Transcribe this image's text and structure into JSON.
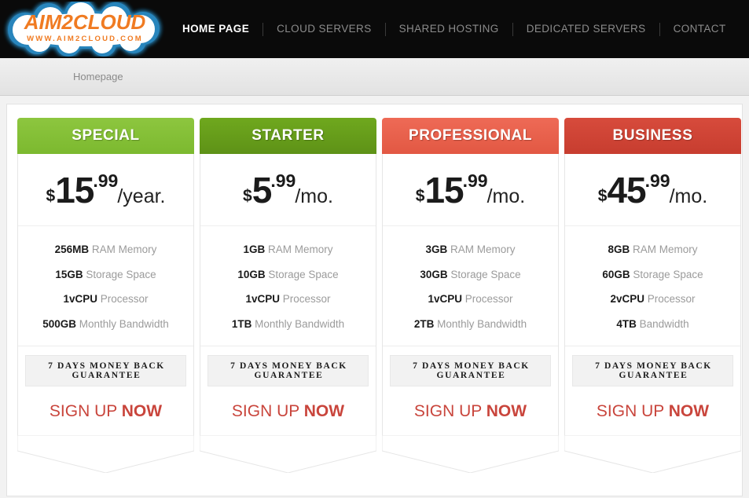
{
  "site": {
    "logo_text": "AIM2CLOUD",
    "logo_sub": "WWW.AIM2CLOUD.COM",
    "logo_color": "#F07B22",
    "logo_glow": "#2E9BDC"
  },
  "nav": {
    "items": [
      {
        "label": "HOME PAGE",
        "active": true
      },
      {
        "label": "CLOUD SERVERS",
        "active": false
      },
      {
        "label": "SHARED HOSTING",
        "active": false
      },
      {
        "label": "DEDICATED SERVERS",
        "active": false
      },
      {
        "label": "CONTACT",
        "active": false
      }
    ]
  },
  "breadcrumb": {
    "label": "Homepage"
  },
  "plans": [
    {
      "name": "SPECIAL",
      "header_color": "#8DC63F",
      "header_color_dark": "#7CB92F",
      "currency": "$",
      "amount": "15",
      "cents": ".99",
      "period": "/year.",
      "features": [
        {
          "value": "256MB",
          "label": "RAM Memory"
        },
        {
          "value": "15GB",
          "label": "Storage Space"
        },
        {
          "value": "1vCPU",
          "label": "Processor"
        },
        {
          "value": "500GB",
          "label": "Monthly Bandwidth"
        }
      ],
      "guarantee": "7 DAYS MONEY BACK GUARANTEE",
      "cta_regular": "SIGN UP ",
      "cta_bold": "NOW"
    },
    {
      "name": "STARTER",
      "header_color": "#6FA81E",
      "header_color_dark": "#5E9217",
      "currency": "$",
      "amount": "5",
      "cents": ".99",
      "period": "/mo.",
      "features": [
        {
          "value": "1GB",
          "label": "RAM Memory"
        },
        {
          "value": "10GB",
          "label": "Storage Space"
        },
        {
          "value": "1vCPU",
          "label": "Processor"
        },
        {
          "value": "1TB",
          "label": "Monthly Bandwidth"
        }
      ],
      "guarantee": "7 DAYS MONEY BACK GUARANTEE",
      "cta_regular": "SIGN UP ",
      "cta_bold": "NOW"
    },
    {
      "name": "PROFESSIONAL",
      "header_color": "#EE6A56",
      "header_color_dark": "#E25843",
      "currency": "$",
      "amount": "15",
      "cents": ".99",
      "period": "/mo.",
      "features": [
        {
          "value": "3GB",
          "label": "RAM Memory"
        },
        {
          "value": "30GB",
          "label": "Storage Space"
        },
        {
          "value": "1vCPU",
          "label": "Processor"
        },
        {
          "value": "2TB",
          "label": "Monthly Bandwidth"
        }
      ],
      "guarantee": "7 DAYS MONEY BACK GUARANTEE",
      "cta_regular": "SIGN UP ",
      "cta_bold": "NOW"
    },
    {
      "name": "BUSINESS",
      "header_color": "#D74B3C",
      "header_color_dark": "#C73D2F",
      "currency": "$",
      "amount": "45",
      "cents": ".99",
      "period": "/mo.",
      "features": [
        {
          "value": "8GB",
          "label": "RAM Memory"
        },
        {
          "value": "60GB",
          "label": "Storage Space"
        },
        {
          "value": "2vCPU",
          "label": "Processor"
        },
        {
          "value": "4TB",
          "label": "Bandwidth"
        }
      ],
      "guarantee": "7 DAYS MONEY BACK GUARANTEE",
      "cta_regular": "SIGN UP ",
      "cta_bold": "NOW"
    }
  ]
}
